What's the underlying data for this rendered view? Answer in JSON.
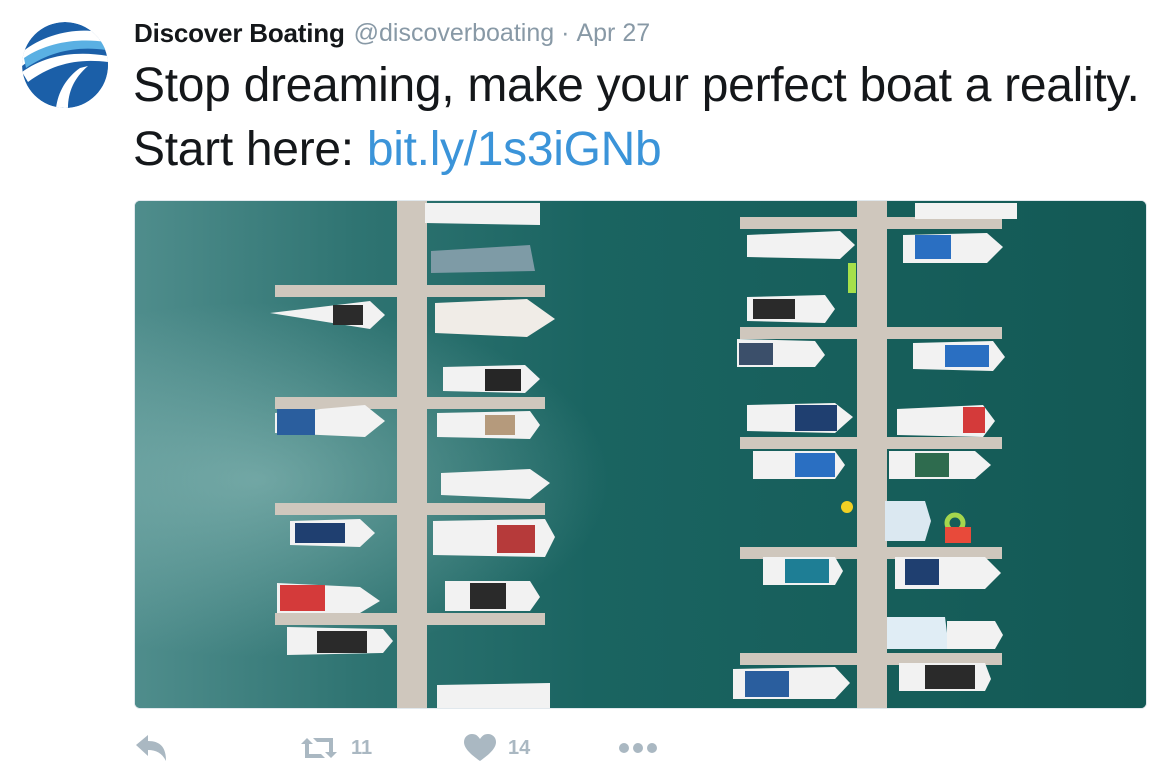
{
  "tweet": {
    "author_name": "Discover Boating",
    "handle": "@discoverboating",
    "separator": "·",
    "date": "Apr 27",
    "text_before_link": "Stop dreaming, make your perfect boat a reality. Start here: ",
    "link_text": "bit.ly/1s3iGNb"
  },
  "media": {
    "subject": "aerial-marina-photo"
  },
  "actions": {
    "reply_icon": "reply-icon",
    "retweet_icon": "retweet-icon",
    "retweet_count": "11",
    "like_icon": "heart-icon",
    "like_count": "14",
    "more_icon": "more-icon"
  },
  "colors": {
    "name": "#14171a",
    "muted": "#8899a6",
    "link": "#3b94d9",
    "action": "#aab8c2",
    "water": "#165e5b",
    "logo_blue": "#1b5fa8",
    "logo_light": "#5ab0e3"
  }
}
